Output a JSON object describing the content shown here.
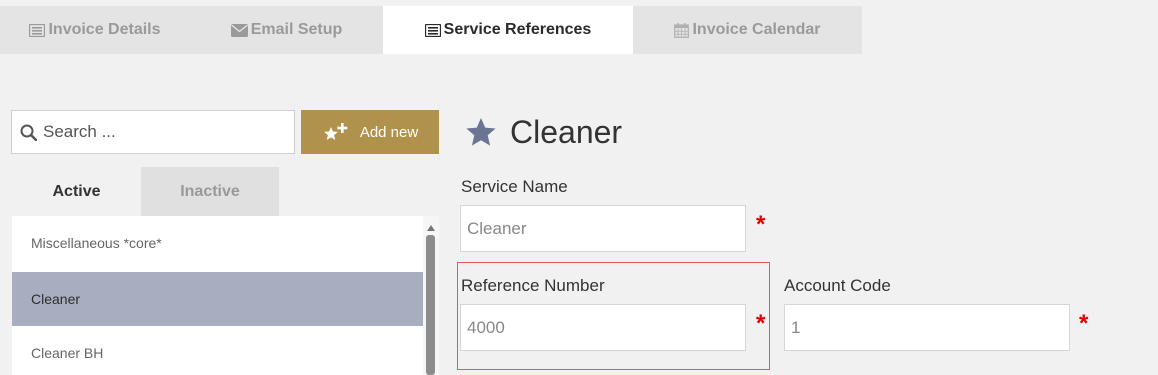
{
  "tabs": [
    {
      "label": "Invoice Details",
      "icon": "list-alt-icon"
    },
    {
      "label": "Email Setup",
      "icon": "envelope-icon"
    },
    {
      "label": "Service References",
      "icon": "list-alt-icon"
    },
    {
      "label": "Invoice Calendar",
      "icon": "calendar-icon"
    }
  ],
  "active_tab": "Service References",
  "search": {
    "placeholder": "Search ...",
    "value": ""
  },
  "add_new": {
    "label": "Add new"
  },
  "list_tabs": {
    "active": "Active",
    "inactive": "Inactive"
  },
  "list_items": [
    {
      "label": "Miscellaneous *core*"
    },
    {
      "label": "Cleaner",
      "selected": true
    },
    {
      "label": "Cleaner BH"
    }
  ],
  "detail": {
    "title": "Cleaner",
    "service_name_label": "Service Name",
    "service_name_value": "Cleaner",
    "reference_number_label": "Reference Number",
    "reference_number_value": "4000",
    "account_code_label": "Account Code",
    "account_code_value": "1",
    "required_marker": "*"
  },
  "colors": {
    "accent_button": "#b0924c",
    "selected_row": "#a7aec0",
    "star": "#6b7493",
    "required": "#e00000",
    "highlight_border": "#e05858"
  }
}
